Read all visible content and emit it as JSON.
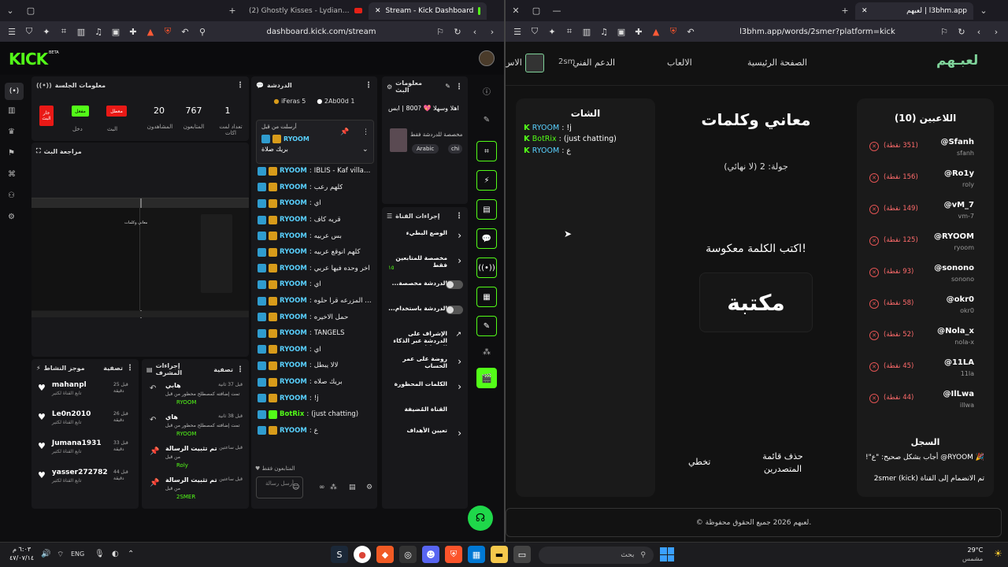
{
  "left_browser": {
    "tabs": [
      {
        "title": "(2) Ghostly Kisses - Lydian (Lyrics Video)",
        "active": false
      },
      {
        "title": "Stream - Kick Dashboard",
        "active": true
      }
    ],
    "url": "dashboard.kick.com/stream",
    "kick": {
      "logo": "KICK",
      "logo_badge": "BETA",
      "session": {
        "title": "معلومات الجلسة",
        "buttons": [
          "جار البث",
          "مفعل",
          "معطل"
        ],
        "button_colors": [
          "#e91916",
          "#53fc18",
          "#e91916"
        ],
        "labels": [
          "دخل",
          "البث"
        ],
        "stats": [
          {
            "value": "20",
            "label": "المشاهدون"
          },
          {
            "value": "767",
            "label": "المتابعون"
          },
          {
            "value": "1",
            "label": "تعداد لمت اكات"
          }
        ]
      },
      "preview": {
        "title": "مراجعة البث",
        "inner_title": "معاني وكلمات"
      },
      "activity": {
        "title": "موجز النشاط",
        "filter": "تصفية",
        "items": [
          {
            "name": "mahanpl",
            "time": "قبل 25 دقيقة",
            "sub": "تابع القناة لكثير"
          },
          {
            "name": "Le0n2010",
            "time": "قبل 26 دقيقة",
            "sub": "تابع القناة لكثير"
          },
          {
            "name": "Jumana1931",
            "time": "قبل 33 دقيقة",
            "sub": "تابع القناة لكثير"
          },
          {
            "name": "yasser272782",
            "time": "قبل 44 دقيقة",
            "sub": "تابع القناة لكثير"
          }
        ]
      },
      "mod_actions": {
        "title": "إجراءات المشرف",
        "filter": "تصفية",
        "items": [
          {
            "title": "هابي",
            "time": "قبل 37 ثانية",
            "desc": "تمت إضافته كمصطلح محظور من قبل",
            "by": "RYOOM"
          },
          {
            "title": "هاي",
            "time": "قبل 38 ثانية",
            "desc": "تمت إضافته كمصطلح محظور من قبل",
            "by": "RYOOM"
          },
          {
            "title": "تم تثبيت الرسالة",
            "time": "قبل ساعتين",
            "desc": "من قبل",
            "by": "Roly"
          },
          {
            "title": "تم تثبيت الرسالة",
            "time": "قبل ساعتين",
            "desc": "من قبل",
            "by": "2SMER"
          }
        ]
      },
      "chat": {
        "title": "الدردشة",
        "top_users": [
          {
            "name": "iFeras",
            "count": "5"
          },
          {
            "name": "2Ab00d",
            "count": "1"
          }
        ],
        "pinned": {
          "label": "أرسلت من قبل",
          "user": "RYOOM",
          "text": "بريك صلاة"
        },
        "messages": [
          {
            "user": "RYOOM",
            "text": "IBLIS - Kaf village - TAngles",
            "bot": false
          },
          {
            "user": "RYOOM",
            "text": "كلهم رعب",
            "bot": false
          },
          {
            "user": "RYOOM",
            "text": "اي",
            "bot": false
          },
          {
            "user": "RYOOM",
            "text": "قريه كاف",
            "bot": false
          },
          {
            "user": "RYOOM",
            "text": "بس عربيه",
            "bot": false
          },
          {
            "user": "RYOOM",
            "text": "كلهم انوقع عربيه",
            "bot": false
          },
          {
            "user": "RYOOM",
            "text": "اخر وحده فيها عربي",
            "bot": false
          },
          {
            "user": "RYOOM",
            "text": "اي",
            "bot": false
          },
          {
            "user": "RYOOM",
            "text": "وفيه محاكي المزرعه قرا حلوه",
            "bot": false
          },
          {
            "user": "RYOOM",
            "text": "حمل الاخيره",
            "bot": false
          },
          {
            "user": "RYOOM",
            "text": "TANGELS",
            "bot": false
          },
          {
            "user": "RYOOM",
            "text": "اي",
            "bot": false
          },
          {
            "user": "RYOOM",
            "text": "لالا يبطل",
            "bot": false
          },
          {
            "user": "RYOOM",
            "text": "بريك صلاه",
            "bot": false
          },
          {
            "user": "RYOOM",
            "text": "!j",
            "bot": false
          },
          {
            "user": "BotRix",
            "text": "(just chatting)",
            "bot": true
          },
          {
            "user": "RYOOM",
            "text": "ع",
            "bot": false
          }
        ],
        "followers_only": "المتابعون فقط",
        "input_placeholder": "أرسل رسالة"
      },
      "stream_info": {
        "title": "معلومات البث",
        "headline": "اهلا وسهلا 💖 ?800 | ابس",
        "category": "مخصصة للدردشة فقط",
        "tags": [
          "Arabic",
          "chi"
        ]
      },
      "channel_actions": {
        "title": "إجراءات القناة",
        "items": [
          {
            "label": "الوضع البطيء",
            "type": "arrow",
            "sub": ""
          },
          {
            "label": "مخصصة للمتابعين فقط",
            "type": "arrow",
            "sub": "١٥"
          },
          {
            "label": "الدردشة مخصصة...",
            "type": "toggle",
            "sub": ""
          },
          {
            "label": "الدردشة باستخدام...",
            "type": "toggle",
            "sub": ""
          },
          {
            "label": "الإشراف على الدردشة عبر الذكاء الاصطناعي",
            "type": "ext",
            "sub": ""
          },
          {
            "label": "روضة على عمر الحساب",
            "type": "arrow",
            "sub": ""
          },
          {
            "label": "الكلمات المحظورة",
            "type": "arrow",
            "sub": ""
          },
          {
            "label": "القناة المُضيفة",
            "type": "none",
            "sub": ""
          },
          {
            "label": "تعيين الأهداف",
            "type": "arrow",
            "sub": ""
          }
        ]
      }
    }
  },
  "right_browser": {
    "tab_title": "لعبهم | l3bhm.app",
    "url": "l3bhm.app/words/2smer?platform=kick",
    "site": {
      "logo": "لعبـهم",
      "nav": [
        "الصفحة الرئيسية",
        "الالعاب",
        "الدعم الفني",
        "الاس"
      ],
      "user_handle": "2sm",
      "players_title": "اللاعبين (10)",
      "players": [
        {
          "name": "@Sfanh",
          "sub": "sfanh",
          "points": "(351 نقطة)"
        },
        {
          "name": "@Ro1y",
          "sub": "roly",
          "points": "(156 نقطة)"
        },
        {
          "name": "@vM_7",
          "sub": "vm-7",
          "points": "(149 نقطة)"
        },
        {
          "name": "@RYOOM",
          "sub": "ryoom",
          "points": "(125 نقطة)"
        },
        {
          "name": "@sonono",
          "sub": "sonono",
          "points": "(93 نقطة)"
        },
        {
          "name": "@okr0",
          "sub": "okr0",
          "points": "(58 نقطة)"
        },
        {
          "name": "@Nola_x",
          "sub": "nola-x",
          "points": "(52 نقطة)"
        },
        {
          "name": "@11LA",
          "sub": "11la",
          "points": "(45 نقطة)"
        },
        {
          "name": "@IlLwa",
          "sub": "illwa",
          "points": "(44 نقطة)"
        }
      ],
      "game_title": "معاني وكلمات",
      "round": "جولة: 2 (لا نهائي)",
      "prompt": "اكتب الكلمة معكوسة!",
      "word": "مكتبة",
      "buttons": [
        "تخطي",
        "حذف قائمة المتصدرين"
      ],
      "chat_title": "الشات",
      "chat": [
        {
          "user": "RYOOM",
          "text": "!j",
          "bot": false
        },
        {
          "user": "BotRix",
          "text": "(just chatting)",
          "bot": true
        },
        {
          "user": "RYOOM",
          "text": "ع",
          "bot": false
        }
      ],
      "log_title": "السجل",
      "log": [
        "🎉 RYOOM@ أجاب بشكل صحيح: \"ع\"!",
        "تم الانضمام إلى القناة 2smer (kick)"
      ],
      "footer": "© لعبهم 2026 جميع الحقوق محفوظة."
    }
  },
  "taskbar": {
    "weather_temp": "29°C",
    "weather_text": "مشمس",
    "search_placeholder": "بحث",
    "lang": "ENG",
    "time": "٦:٠٣ م",
    "date": "٤٧/٠٧/١٤"
  },
  "colors": {
    "kick_green": "#53fc18",
    "danger": "#e91916",
    "panel": "#18181b"
  }
}
